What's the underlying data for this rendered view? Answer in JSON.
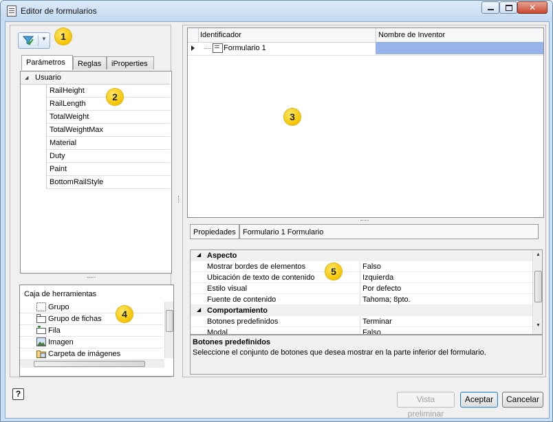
{
  "window": {
    "title": "Editor de formularios",
    "icon": "form-editor-icon"
  },
  "toolbar": {
    "filter_icon": "filter-icon"
  },
  "tabs": [
    "Parámetros",
    "Reglas",
    "iProperties"
  ],
  "parameters": {
    "group": "Usuario",
    "items": [
      "RailHeight",
      "RailLength",
      "TotalWeight",
      "TotalWeightMax",
      "Material",
      "Duty",
      "Paint",
      "BottomRailStyle"
    ]
  },
  "toolbox": {
    "title": "Caja de herramientas",
    "items": [
      "Grupo",
      "Grupo de fichas",
      "Fila",
      "Imagen",
      "Carpeta de imágenes"
    ]
  },
  "grid": {
    "columns": [
      "Identificador",
      "Nombre de Inventor"
    ],
    "rows": [
      {
        "name": "Formulario 1",
        "inventor_name": ""
      }
    ]
  },
  "properties": {
    "label": "Propiedades",
    "title": "Formulario 1 Formulario",
    "categories": [
      {
        "name": "Aspecto",
        "rows": [
          {
            "key": "Mostrar bordes de elementos",
            "value": "Falso"
          },
          {
            "key": "Ubicación de texto de contenido",
            "value": "Izquierda"
          },
          {
            "key": "Estilo visual",
            "value": "Por defecto"
          },
          {
            "key": "Fuente de contenido",
            "value": "Tahoma; 8pto."
          }
        ]
      },
      {
        "name": "Comportamiento",
        "rows": [
          {
            "key": "Botones predefinidos",
            "value": "Terminar"
          },
          {
            "key": "Modal",
            "value": "Falso"
          }
        ]
      }
    ],
    "help_title": "Botones predefinidos",
    "help_desc": "Seleccione el conjunto de botones que desea mostrar en la parte inferior del formulario."
  },
  "buttons": {
    "preview": "Vista preliminar",
    "accept": "Aceptar",
    "cancel": "Cancelar",
    "help_icon": "help-icon"
  },
  "callouts": [
    "1",
    "2",
    "3",
    "4",
    "5"
  ],
  "colors": {
    "selection": "#98b2ea",
    "callout": "#f5c400",
    "title_bar": "#c9dff3"
  }
}
